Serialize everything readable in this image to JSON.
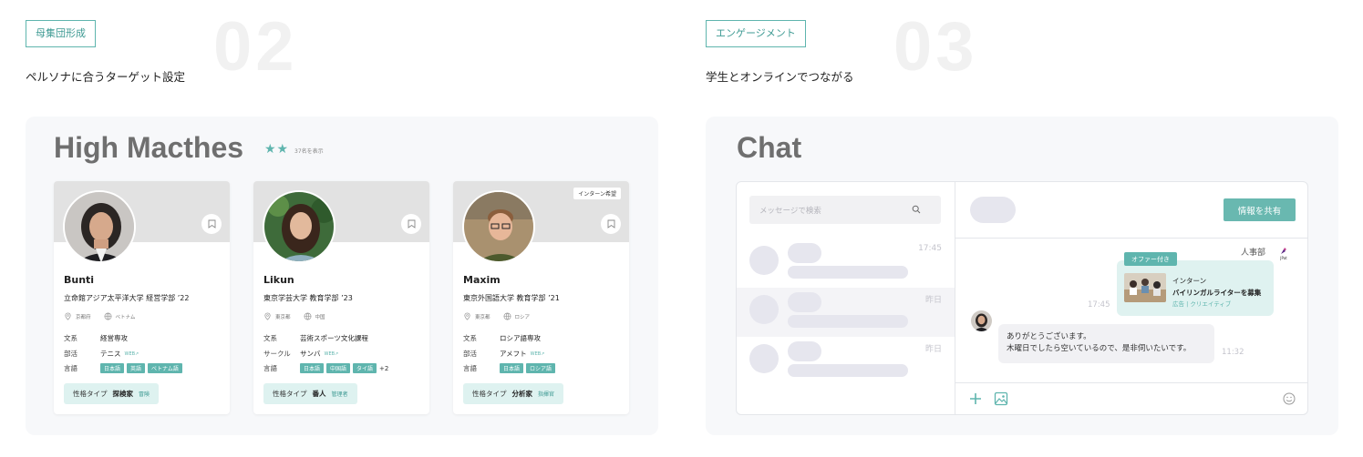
{
  "colors": {
    "accent": "#5fb5ae",
    "accent_light": "#def2f0",
    "panel_bg": "#f7f8fa",
    "skeleton": "#e6e6ee"
  },
  "section1": {
    "tag": "母集団形成",
    "number": "02",
    "subtitle": "ペルソナに合うターゲット設定",
    "panel_title": "High Macthes",
    "stars": "★★",
    "star_note": "37名を表示",
    "cards": [
      {
        "name": "Bunti",
        "school": "立命館アジア太平洋大学 経営学部 ’22",
        "location": "京都府",
        "nationality": "ベトナム",
        "major_label": "文系",
        "major_value": "経営専攻",
        "club_label": "部活",
        "club_value": "テニス",
        "club_web": "WEB",
        "lang_label": "言語",
        "languages": [
          "日本語",
          "英語",
          "ベトナム語"
        ],
        "lang_more": "",
        "type_label": "性格タイプ",
        "type_value": "探検家",
        "type_sub": "冒険",
        "intern_tag": "",
        "icons": {
          "bookmark": "bookmark-icon",
          "location": "pin-icon",
          "nationality": "globe-icon"
        }
      },
      {
        "name": "Likun",
        "school": "東京学芸大学 教育学部 ’23",
        "location": "東京都",
        "nationality": "中国",
        "major_label": "文系",
        "major_value": "芸術スポーツ文化課程",
        "club_label": "サークル",
        "club_value": "サンバ",
        "club_web": "WEB",
        "lang_label": "言語",
        "languages": [
          "日本語",
          "中国語",
          "タイ語"
        ],
        "lang_more": "+2",
        "type_label": "性格タイプ",
        "type_value": "番人",
        "type_sub": "管理者",
        "intern_tag": ""
      },
      {
        "name": "Maxim",
        "school": "東京外国語大学 教育学部 ’21",
        "location": "東京都",
        "nationality": "ロシア",
        "major_label": "文系",
        "major_value": "ロシア語専攻",
        "club_label": "部活",
        "club_value": "アメフト",
        "club_web": "WEB",
        "lang_label": "言語",
        "languages": [
          "日本語",
          "ロシア語"
        ],
        "lang_more": "",
        "type_label": "性格タイプ",
        "type_value": "分析家",
        "type_sub": "指揮官",
        "intern_tag": "インターン希望"
      }
    ]
  },
  "section2": {
    "tag": "エンゲージメント",
    "number": "03",
    "subtitle": "学生とオンラインでつながる",
    "panel_title": "Chat",
    "search_placeholder": "メッセージで検索",
    "threads": [
      {
        "time": "17:45"
      },
      {
        "time": "昨日"
      },
      {
        "time": "昨日"
      }
    ],
    "share_button": "情報を共有",
    "sender_dept": "人事部",
    "jpat_logo": "JPat",
    "offer": {
      "tag": "オファー付き",
      "line1": "インターン",
      "line2": "バイリンガルライターを募集",
      "line3": "広告 | クリエイティブ",
      "time": "17:45"
    },
    "reply": {
      "line1": "ありがとうございます。",
      "line2": "木曜日でしたら空いているので、是非伺いたいです。",
      "time": "11:32"
    },
    "icons": {
      "add": "plus-icon",
      "image": "image-icon",
      "emoji": "smile-icon",
      "search": "search-icon"
    }
  }
}
